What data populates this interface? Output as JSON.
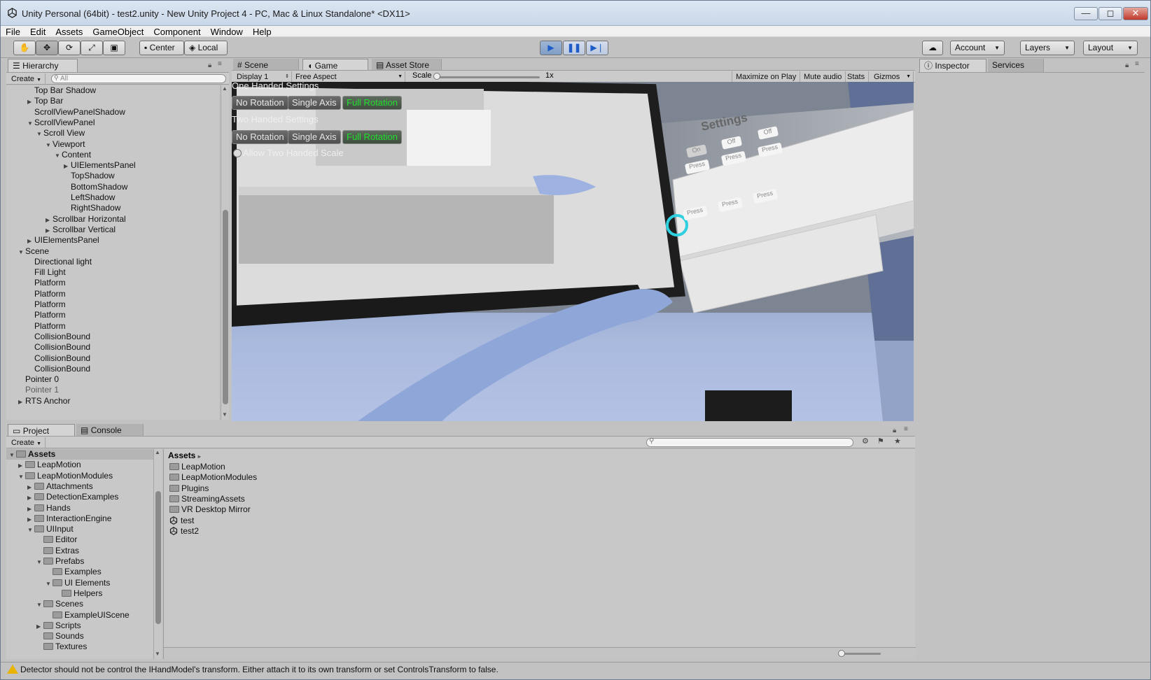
{
  "window": {
    "title": "Unity Personal (64bit) - test2.unity - New Unity Project 4 - PC, Mac & Linux Standalone* <DX11>",
    "controls": [
      "—",
      "◻",
      "✕"
    ]
  },
  "menu": [
    "File",
    "Edit",
    "Assets",
    "GameObject",
    "Component",
    "Window",
    "Help"
  ],
  "toolbar": {
    "pivot": "Center",
    "space": "Local",
    "account": "Account",
    "layers": "Layers",
    "layout": "Layout"
  },
  "hierarchy": {
    "tab": "Hierarchy",
    "create": "Create",
    "search_placeholder": "All",
    "rows": [
      {
        "label": "Top Bar Shadow",
        "depth": 2,
        "arrow": "",
        "grey": false
      },
      {
        "label": "Top Bar",
        "depth": 2,
        "arrow": "▶",
        "grey": false
      },
      {
        "label": "ScrollViewPanelShadow",
        "depth": 2,
        "arrow": "",
        "grey": false
      },
      {
        "label": "ScrollViewPanel",
        "depth": 2,
        "arrow": "▼",
        "grey": false
      },
      {
        "label": "Scroll View",
        "depth": 3,
        "arrow": "▼",
        "grey": false
      },
      {
        "label": "Viewport",
        "depth": 4,
        "arrow": "▼",
        "grey": false
      },
      {
        "label": "Content",
        "depth": 5,
        "arrow": "▼",
        "grey": false
      },
      {
        "label": "UIElementsPanel",
        "depth": 6,
        "arrow": "▶",
        "grey": false
      },
      {
        "label": "TopShadow",
        "depth": 6,
        "arrow": "",
        "grey": false
      },
      {
        "label": "BottomShadow",
        "depth": 6,
        "arrow": "",
        "grey": false
      },
      {
        "label": "LeftShadow",
        "depth": 6,
        "arrow": "",
        "grey": false
      },
      {
        "label": "RightShadow",
        "depth": 6,
        "arrow": "",
        "grey": false
      },
      {
        "label": "Scrollbar Horizontal",
        "depth": 4,
        "arrow": "▶",
        "grey": false
      },
      {
        "label": "Scrollbar Vertical",
        "depth": 4,
        "arrow": "▶",
        "grey": false
      },
      {
        "label": "UIElementsPanel",
        "depth": 2,
        "arrow": "▶",
        "grey": false
      },
      {
        "label": "Scene",
        "depth": 1,
        "arrow": "▼",
        "grey": false
      },
      {
        "label": "Directional light",
        "depth": 2,
        "arrow": "",
        "grey": false
      },
      {
        "label": "Fill Light",
        "depth": 2,
        "arrow": "",
        "grey": false
      },
      {
        "label": "Platform",
        "depth": 2,
        "arrow": "",
        "grey": false
      },
      {
        "label": "Platform",
        "depth": 2,
        "arrow": "",
        "grey": false
      },
      {
        "label": "Platform",
        "depth": 2,
        "arrow": "",
        "grey": false
      },
      {
        "label": "Platform",
        "depth": 2,
        "arrow": "",
        "grey": false
      },
      {
        "label": "Platform",
        "depth": 2,
        "arrow": "",
        "grey": false
      },
      {
        "label": "CollisionBound",
        "depth": 2,
        "arrow": "",
        "grey": false
      },
      {
        "label": "CollisionBound",
        "depth": 2,
        "arrow": "",
        "grey": false
      },
      {
        "label": "CollisionBound",
        "depth": 2,
        "arrow": "",
        "grey": false
      },
      {
        "label": "CollisionBound",
        "depth": 2,
        "arrow": "",
        "grey": false
      },
      {
        "label": "Pointer 0",
        "depth": 1,
        "arrow": "",
        "grey": false
      },
      {
        "label": "Pointer 1",
        "depth": 1,
        "arrow": "",
        "grey": true
      },
      {
        "label": "RTS Anchor",
        "depth": 1,
        "arrow": "▶",
        "grey": false
      }
    ]
  },
  "center_tabs": {
    "scene": "Scene",
    "game": "Game",
    "asset_store": "Asset Store"
  },
  "game_bar": {
    "display": "Display 1",
    "aspect": "Free Aspect",
    "scale_label": "Scale",
    "scale_value": "1x",
    "maximize": "Maximize on Play",
    "mute": "Mute audio",
    "stats": "Stats",
    "gizmos": "Gizmos"
  },
  "game_overlay": {
    "one_handed": "One Handed Settings",
    "two_handed": "Two Handed Settings",
    "no_rotation": "No Rotation",
    "single_axis": "Single Axis",
    "full_rotation": "Full Rotation",
    "allow_two_handed": "Allow Two Handed Scale",
    "settings_title": "Settings",
    "off": "Off",
    "on": "On",
    "press": "Press"
  },
  "inspector": {
    "tab": "Inspector",
    "services": "Services"
  },
  "project": {
    "tab": "Project",
    "console": "Console",
    "create": "Create",
    "tree": [
      {
        "label": "Assets",
        "depth": 0,
        "arrow": "▼",
        "bold": true
      },
      {
        "label": "LeapMotion",
        "depth": 1,
        "arrow": "▶",
        "bold": false
      },
      {
        "label": "LeapMotionModules",
        "depth": 1,
        "arrow": "▼",
        "bold": false
      },
      {
        "label": "Attachments",
        "depth": 2,
        "arrow": "▶",
        "bold": false
      },
      {
        "label": "DetectionExamples",
        "depth": 2,
        "arrow": "▶",
        "bold": false
      },
      {
        "label": "Hands",
        "depth": 2,
        "arrow": "▶",
        "bold": false
      },
      {
        "label": "InteractionEngine",
        "depth": 2,
        "arrow": "▶",
        "bold": false
      },
      {
        "label": "UIInput",
        "depth": 2,
        "arrow": "▼",
        "bold": false
      },
      {
        "label": "Editor",
        "depth": 3,
        "arrow": "",
        "bold": false
      },
      {
        "label": "Extras",
        "depth": 3,
        "arrow": "",
        "bold": false
      },
      {
        "label": "Prefabs",
        "depth": 3,
        "arrow": "▼",
        "bold": false
      },
      {
        "label": "Examples",
        "depth": 4,
        "arrow": "",
        "bold": false
      },
      {
        "label": "UI Elements",
        "depth": 4,
        "arrow": "▼",
        "bold": false
      },
      {
        "label": "Helpers",
        "depth": 5,
        "arrow": "",
        "bold": false
      },
      {
        "label": "Scenes",
        "depth": 3,
        "arrow": "▼",
        "bold": false
      },
      {
        "label": "ExampleUIScene",
        "depth": 4,
        "arrow": "",
        "bold": false
      },
      {
        "label": "Scripts",
        "depth": 3,
        "arrow": "▶",
        "bold": false
      },
      {
        "label": "Sounds",
        "depth": 3,
        "arrow": "",
        "bold": false
      },
      {
        "label": "Textures",
        "depth": 3,
        "arrow": "",
        "bold": false
      }
    ],
    "breadcrumb": "Assets",
    "items": [
      {
        "label": "LeapMotion",
        "kind": "folder"
      },
      {
        "label": "LeapMotionModules",
        "kind": "folder"
      },
      {
        "label": "Plugins",
        "kind": "folder"
      },
      {
        "label": "StreamingAssets",
        "kind": "folder"
      },
      {
        "label": "VR Desktop Mirror",
        "kind": "folder"
      },
      {
        "label": "test",
        "kind": "scene"
      },
      {
        "label": "test2",
        "kind": "scene"
      }
    ]
  },
  "status": {
    "message": "Detector should not be control the IHandModel's transform. Either attach it to its own transform or set ControlsTransform to false."
  }
}
